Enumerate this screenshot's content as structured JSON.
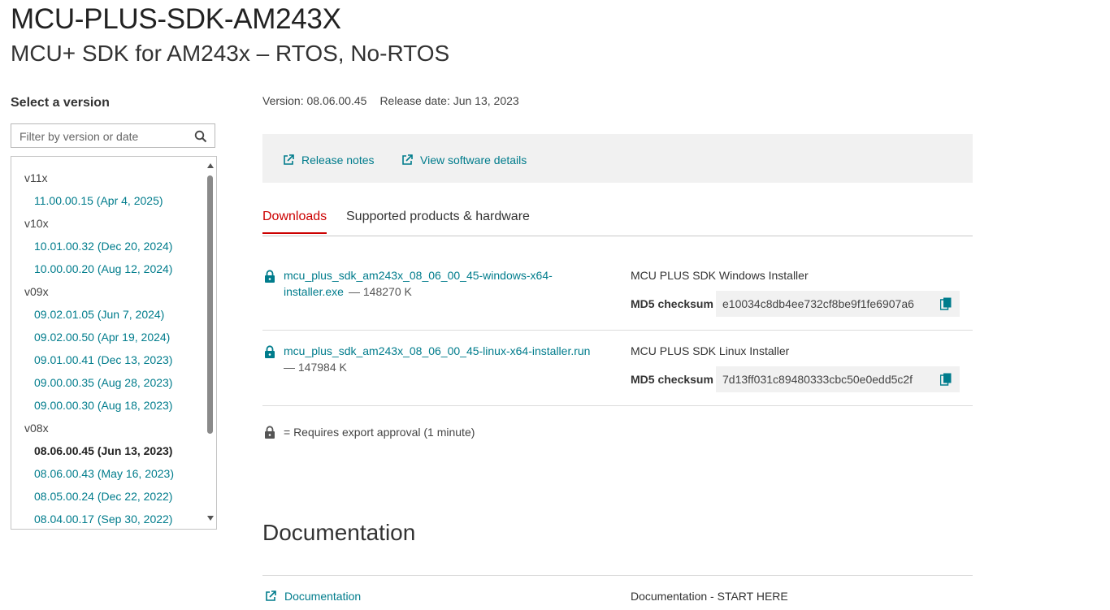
{
  "page": {
    "title": "MCU-PLUS-SDK-AM243X",
    "subtitle": "MCU+ SDK for AM243x – RTOS, No-RTOS"
  },
  "sidebar": {
    "heading": "Select a version",
    "filter_placeholder": "Filter by version or date",
    "groups": [
      {
        "label": "v11x",
        "items": [
          "11.00.00.15 (Apr 4, 2025)"
        ]
      },
      {
        "label": "v10x",
        "items": [
          "10.01.00.32 (Dec 20, 2024)",
          "10.00.00.20 (Aug 12, 2024)"
        ]
      },
      {
        "label": "v09x",
        "items": [
          "09.02.01.05 (Jun 7, 2024)",
          "09.02.00.50 (Apr 19, 2024)",
          "09.01.00.41 (Dec 13, 2023)",
          "09.00.00.35 (Aug 28, 2023)",
          "09.00.00.30 (Aug 18, 2023)"
        ]
      },
      {
        "label": "v08x",
        "items": [
          "08.06.00.45 (Jun 13, 2023)",
          "08.06.00.43 (May 16, 2023)",
          "08.05.00.24 (Dec 22, 2022)",
          "08.04.00.17 (Sep 30, 2022)"
        ]
      }
    ],
    "selected": "08.06.00.45 (Jun 13, 2023)"
  },
  "release": {
    "version": "Version: 08.06.00.45",
    "date": "Release date: Jun 13, 2023"
  },
  "links": {
    "release_notes": "Release notes",
    "software_details": "View software details"
  },
  "tabs": [
    {
      "label": "Downloads",
      "active": true
    },
    {
      "label": "Supported products & hardware",
      "active": false
    }
  ],
  "downloads": [
    {
      "file_line1": "mcu_plus_sdk_am243x_08_06_00_45-windows-x64-",
      "file_line2": "installer.exe",
      "size": "— 148270 K",
      "description": "MCU PLUS SDK Windows Installer",
      "md5_label": "MD5 checksum",
      "md5": "e10034c8db4ee732cf8be9f1fe6907a6"
    },
    {
      "file_line1": "mcu_plus_sdk_am243x_08_06_00_45-linux-x64-installer.run",
      "file_line2": "",
      "size": "— 147984 K",
      "description": "MCU PLUS SDK Linux Installer",
      "md5_label": "MD5 checksum",
      "md5": "7d13ff031c89480333cbc50e0edd5c2f"
    }
  ],
  "legend": "= Requires export approval (1 minute)",
  "documentation": {
    "heading": "Documentation",
    "link": "Documentation",
    "description": "Documentation - START HERE"
  },
  "colors": {
    "link": "#007c8c",
    "active_tab": "#cc0000",
    "panel": "#f1f1f1"
  }
}
